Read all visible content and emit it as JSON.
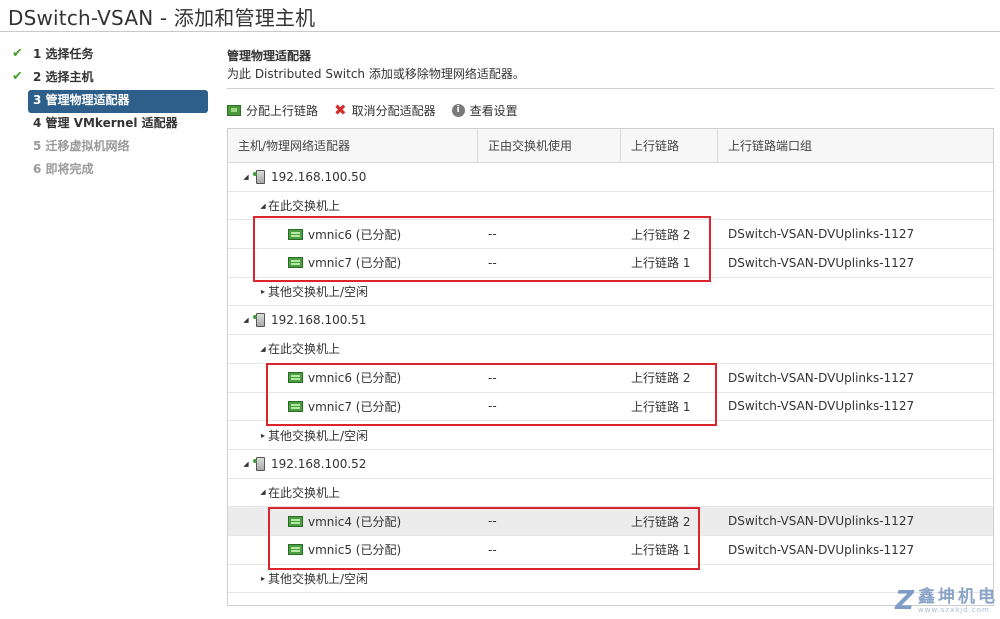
{
  "window": {
    "title": "DSwitch-VSAN - 添加和管理主机"
  },
  "steps": [
    {
      "label": "1 选择任务",
      "state": "done"
    },
    {
      "label": "2 选择主机",
      "state": "done"
    },
    {
      "label": "3 管理物理适配器",
      "state": "active"
    },
    {
      "label": "4 管理 VMkernel 适配器",
      "state": "pending"
    },
    {
      "label": "5 迁移虚拟机网络",
      "state": "disabled"
    },
    {
      "label": "6 即将完成",
      "state": "disabled"
    }
  ],
  "main": {
    "heading": "管理物理适配器",
    "subheading": "为此 Distributed Switch 添加或移除物理网络适配器。"
  },
  "toolbar": {
    "assign_label": "分配上行链路",
    "unassign_label": "取消分配适配器",
    "view_label": "查看设置"
  },
  "grid": {
    "columns": [
      "主机/物理网络适配器",
      "正由交换机使用",
      "上行链路",
      "上行链路端口组"
    ],
    "hosts": [
      {
        "name": "192.168.100.50",
        "group_label": "在此交换机上",
        "other_label": "其他交换机上/空闲",
        "nics": [
          {
            "name": "vmnic6 (已分配)",
            "in_use": "--",
            "uplink": "上行链路 2",
            "portgroup": "DSwitch-VSAN-DVUplinks-1127"
          },
          {
            "name": "vmnic7 (已分配)",
            "in_use": "--",
            "uplink": "上行链路 1",
            "portgroup": "DSwitch-VSAN-DVUplinks-1127"
          }
        ]
      },
      {
        "name": "192.168.100.51",
        "group_label": "在此交换机上",
        "other_label": "其他交换机上/空闲",
        "nics": [
          {
            "name": "vmnic6 (已分配)",
            "in_use": "--",
            "uplink": "上行链路 2",
            "portgroup": "DSwitch-VSAN-DVUplinks-1127"
          },
          {
            "name": "vmnic7 (已分配)",
            "in_use": "--",
            "uplink": "上行链路 1",
            "portgroup": "DSwitch-VSAN-DVUplinks-1127"
          }
        ]
      },
      {
        "name": "192.168.100.52",
        "group_label": "在此交换机上",
        "other_label": "其他交换机上/空闲",
        "nics": [
          {
            "name": "vmnic4 (已分配)",
            "in_use": "--",
            "uplink": "上行链路 2",
            "portgroup": "DSwitch-VSAN-DVUplinks-1127"
          },
          {
            "name": "vmnic5 (已分配)",
            "in_use": "--",
            "uplink": "上行链路 1",
            "portgroup": "DSwitch-VSAN-DVUplinks-1127"
          }
        ]
      }
    ]
  },
  "watermark": {
    "mark": "Z",
    "text": "鑫坤机电",
    "sub": "www.szxkjd.com"
  },
  "colors": {
    "active_step": "#2e5f8a",
    "highlight": "#d9262c",
    "check": "#4a9e2f"
  }
}
